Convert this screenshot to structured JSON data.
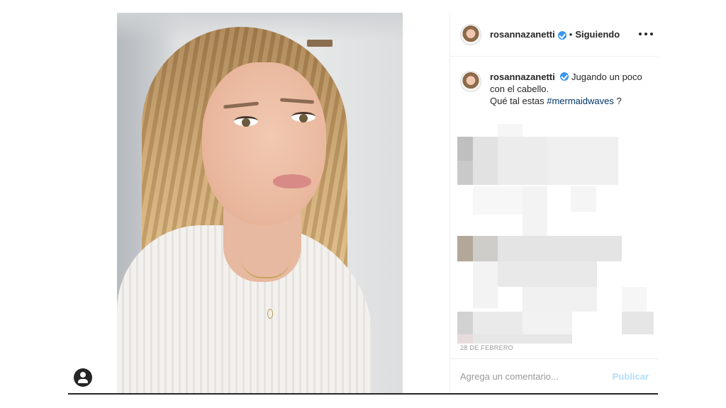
{
  "post": {
    "username": "rosannazanetti",
    "separator": "•",
    "follow_status": "Siguiendo",
    "caption_line1": "Jugando un poco",
    "caption_line2": "con el cabello.",
    "caption_line3_prefix": "Qué tal estas ",
    "hashtag": "#mermaidwaves",
    "caption_line3_suffix": " ?",
    "date": "28 DE FEBRERO",
    "comment_placeholder": "Agrega un comentario...",
    "publish_label": "Publicar"
  },
  "icons": {
    "verified": "verified-badge-icon",
    "more": "more-options-icon",
    "profile": "user-profile-icon"
  },
  "colors": {
    "verified_blue": "#3897f0",
    "hashtag_link": "#003569",
    "publish_disabled": "#b2dffc",
    "muted_text": "#999999"
  }
}
